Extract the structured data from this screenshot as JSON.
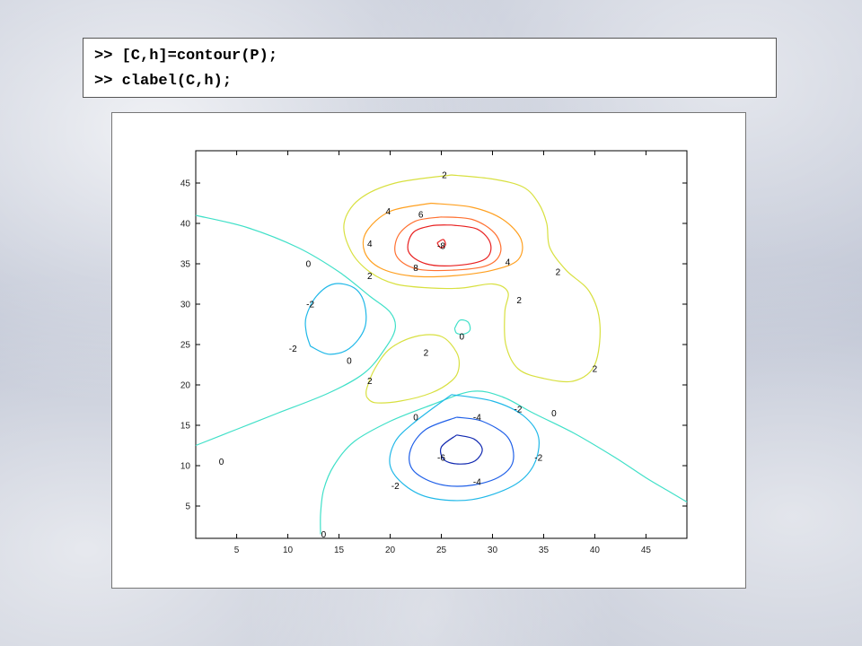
{
  "code": {
    "line1": ">> [C,h]=contour(P);",
    "line2": ">> clabel(C,h);"
  },
  "chart_data": {
    "type": "contour",
    "xlim": [
      1,
      49
    ],
    "ylim": [
      1,
      49
    ],
    "xticks": [
      5,
      10,
      15,
      20,
      25,
      30,
      35,
      40,
      45
    ],
    "yticks": [
      5,
      10,
      15,
      20,
      25,
      30,
      35,
      40,
      45
    ],
    "levels": [
      {
        "level": 0,
        "color": "#40e0c8",
        "paths": [
          [
            [
              1,
              41
            ],
            [
              6,
              39.5
            ],
            [
              11,
              37
            ],
            [
              15,
              34
            ],
            [
              18,
              31
            ],
            [
              20,
              29
            ],
            [
              20.5,
              27
            ],
            [
              19.5,
              24.5
            ],
            [
              17.5,
              21.5
            ],
            [
              14,
              19
            ],
            [
              9,
              16.5
            ],
            [
              5,
              14.5
            ],
            [
              1,
              12.5
            ]
          ],
          [
            [
              13.2,
              1.5
            ],
            [
              13.2,
              4
            ],
            [
              13.5,
              7
            ],
            [
              14.5,
              10
            ],
            [
              16.5,
              13
            ],
            [
              20,
              15.5
            ],
            [
              24,
              17.5
            ],
            [
              28,
              19.2
            ],
            [
              31,
              18.5
            ],
            [
              34,
              16.5
            ],
            [
              38,
              14
            ],
            [
              42,
              11
            ],
            [
              45,
              8.5
            ],
            [
              47,
              7
            ],
            [
              49,
              5.5
            ]
          ],
          [
            [
              26.3,
              27
            ],
            [
              26.8,
              28
            ],
            [
              27.6,
              27.8
            ],
            [
              27.8,
              26.8
            ],
            [
              27.2,
              26.3
            ],
            [
              26.5,
              26.4
            ],
            [
              26.3,
              27
            ]
          ]
        ]
      },
      {
        "level": 2,
        "color": "#d8e040",
        "paths": [
          [
            [
              26,
              46
            ],
            [
              30,
              45.5
            ],
            [
              33,
              44.5
            ],
            [
              34.5,
              42.5
            ],
            [
              35.3,
              40
            ],
            [
              35.6,
              37
            ],
            [
              37.2,
              34.2
            ],
            [
              39.5,
              31.5
            ],
            [
              40.5,
              27.5
            ],
            [
              40,
              22.5
            ],
            [
              38,
              20.5
            ],
            [
              35,
              20.8
            ],
            [
              32.5,
              22
            ],
            [
              31.3,
              25
            ],
            [
              31.2,
              29
            ],
            [
              31.5,
              31.5
            ],
            [
              30,
              32.5
            ],
            [
              27,
              32
            ],
            [
              24,
              32
            ],
            [
              20.5,
              32.5
            ],
            [
              18,
              34
            ],
            [
              16.2,
              36.5
            ],
            [
              15.5,
              40
            ],
            [
              17,
              43
            ],
            [
              20.5,
              45
            ],
            [
              26,
              46
            ]
          ],
          [
            [
              17.7,
              18.5
            ],
            [
              17.7,
              19.5
            ],
            [
              18.5,
              22
            ],
            [
              20,
              24.5
            ],
            [
              22.5,
              26
            ],
            [
              25,
              26
            ],
            [
              26.5,
              24
            ],
            [
              26.7,
              22
            ],
            [
              26,
              20.5
            ],
            [
              24,
              19
            ],
            [
              21,
              18
            ],
            [
              18.5,
              17.8
            ],
            [
              17.7,
              18.5
            ]
          ]
        ]
      },
      {
        "level": 4,
        "color": "#ffa020",
        "paths": [
          [
            [
              24,
              42.5
            ],
            [
              28,
              42
            ],
            [
              31,
              40.5
            ],
            [
              32.8,
              38
            ],
            [
              32.5,
              35.5
            ],
            [
              30,
              34.2
            ],
            [
              26,
              33.5
            ],
            [
              22,
              33.5
            ],
            [
              19,
              34.5
            ],
            [
              17.5,
              36.5
            ],
            [
              17.7,
              39
            ],
            [
              20,
              41.5
            ],
            [
              24,
              42.5
            ]
          ]
        ]
      },
      {
        "level": 6,
        "color": "#ff7030",
        "paths": [
          [
            [
              25,
              40.8
            ],
            [
              28,
              40.5
            ],
            [
              30.2,
              38.8
            ],
            [
              30.8,
              36.5
            ],
            [
              29.5,
              34.8
            ],
            [
              26,
              34.2
            ],
            [
              22.5,
              34.4
            ],
            [
              20.6,
              36
            ],
            [
              20.8,
              38.5
            ],
            [
              22.5,
              40.3
            ],
            [
              25,
              40.8
            ]
          ]
        ]
      },
      {
        "level": 8,
        "color": "#e82020",
        "paths": [
          [
            [
              26,
              39.8
            ],
            [
              28.5,
              39.3
            ],
            [
              29.8,
              37.5
            ],
            [
              29.3,
              35.6
            ],
            [
              26.5,
              34.8
            ],
            [
              23.5,
              35
            ],
            [
              21.8,
              36.5
            ],
            [
              22.2,
              38.8
            ],
            [
              24,
              39.7
            ],
            [
              26,
              39.8
            ]
          ],
          [
            [
              24.6,
              37.6
            ],
            [
              25.2,
              38
            ],
            [
              25.4,
              37.3
            ],
            [
              24.9,
              37
            ],
            [
              24.6,
              37.6
            ]
          ]
        ]
      },
      {
        "level": -2,
        "color": "#20b8e8",
        "paths": [
          [
            [
              12.2,
              24.8
            ],
            [
              14,
              23.8
            ],
            [
              16,
              24.5
            ],
            [
              17.5,
              27
            ],
            [
              17.5,
              30
            ],
            [
              16.5,
              32
            ],
            [
              14.5,
              32.5
            ],
            [
              12.8,
              31
            ],
            [
              11.8,
              28.5
            ],
            [
              11.8,
              26.5
            ],
            [
              12.2,
              24.8
            ]
          ],
          [
            [
              26,
              18.8
            ],
            [
              30,
              18
            ],
            [
              33,
              16.2
            ],
            [
              34.5,
              13.5
            ],
            [
              34,
              10
            ],
            [
              32,
              7.5
            ],
            [
              28,
              5.8
            ],
            [
              24,
              6
            ],
            [
              21.5,
              7.5
            ],
            [
              20,
              10
            ],
            [
              20.5,
              13
            ],
            [
              22.5,
              15.5
            ],
            [
              26,
              18.8
            ]
          ]
        ]
      },
      {
        "level": -4,
        "color": "#2060e8",
        "paths": [
          [
            [
              26.5,
              16
            ],
            [
              29,
              15.5
            ],
            [
              31.5,
              13.5
            ],
            [
              32,
              10.5
            ],
            [
              30.5,
              8.5
            ],
            [
              27.5,
              7.5
            ],
            [
              24.5,
              7.8
            ],
            [
              22.2,
              9.5
            ],
            [
              22,
              12
            ],
            [
              23.5,
              14.5
            ],
            [
              26.5,
              16
            ]
          ]
        ]
      },
      {
        "level": -6,
        "color": "#1028b0",
        "paths": [
          [
            [
              26.5,
              13.8
            ],
            [
              28.2,
              13.3
            ],
            [
              29,
              12
            ],
            [
              28.3,
              10.6
            ],
            [
              26.8,
              10.2
            ],
            [
              25.3,
              10.7
            ],
            [
              25,
              12.3
            ],
            [
              26.5,
              13.8
            ]
          ]
        ]
      }
    ],
    "labels": [
      {
        "text": "2",
        "x": 25.3,
        "y": 46.0
      },
      {
        "text": "4",
        "x": 19.8,
        "y": 41.5
      },
      {
        "text": "6",
        "x": 23.0,
        "y": 41.1
      },
      {
        "text": "4",
        "x": 18.0,
        "y": 37.5
      },
      {
        "text": "-8",
        "x": 25.0,
        "y": 37.2
      },
      {
        "text": "4",
        "x": 31.5,
        "y": 35.2
      },
      {
        "text": "8",
        "x": 22.5,
        "y": 34.5
      },
      {
        "text": "2",
        "x": 18.0,
        "y": 33.5
      },
      {
        "text": "2",
        "x": 36.4,
        "y": 34.0
      },
      {
        "text": "0",
        "x": 12.0,
        "y": 35.0
      },
      {
        "text": "2",
        "x": 32.6,
        "y": 30.5
      },
      {
        "text": "-2",
        "x": 12.2,
        "y": 30.0
      },
      {
        "text": "0",
        "x": 27.0,
        "y": 26.0
      },
      {
        "text": "-2",
        "x": 10.5,
        "y": 24.5
      },
      {
        "text": "2",
        "x": 23.5,
        "y": 24.0
      },
      {
        "text": "0",
        "x": 16.0,
        "y": 23.0
      },
      {
        "text": "2",
        "x": 40.0,
        "y": 22.0
      },
      {
        "text": "2",
        "x": 18.0,
        "y": 20.5
      },
      {
        "text": "-2",
        "x": 32.5,
        "y": 17.0
      },
      {
        "text": "0",
        "x": 36.0,
        "y": 16.5
      },
      {
        "text": "0",
        "x": 22.5,
        "y": 16.0
      },
      {
        "text": "-4",
        "x": 28.5,
        "y": 16.0
      },
      {
        "text": "-6",
        "x": 25.0,
        "y": 11.0
      },
      {
        "text": "-2",
        "x": 34.5,
        "y": 11.0
      },
      {
        "text": "0",
        "x": 3.5,
        "y": 10.5
      },
      {
        "text": "-4",
        "x": 28.5,
        "y": 8.0
      },
      {
        "text": "-2",
        "x": 20.5,
        "y": 7.5
      },
      {
        "text": "0",
        "x": 13.5,
        "y": 1.5
      }
    ]
  }
}
